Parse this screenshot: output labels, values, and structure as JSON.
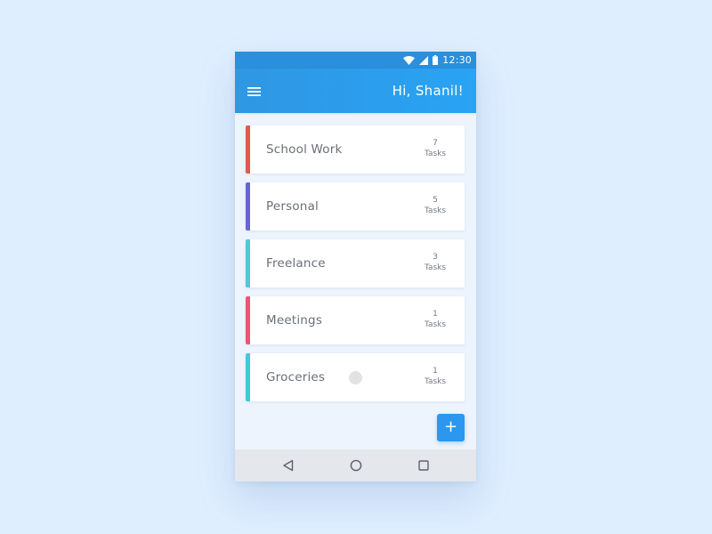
{
  "status_bar": {
    "time": "12:30",
    "icons": [
      "wifi-icon",
      "signal-icon",
      "battery-icon"
    ]
  },
  "app_bar": {
    "greeting": "Hi, Shanil!",
    "menu_icon": "menu-icon",
    "background": "#2a9df0"
  },
  "categories": [
    {
      "name": "School Work",
      "count": "7",
      "count_label": "Tasks",
      "color": "#e05a4f"
    },
    {
      "name": "Personal",
      "count": "5",
      "count_label": "Tasks",
      "color": "#6b63d8"
    },
    {
      "name": "Freelance",
      "count": "3",
      "count_label": "Tasks",
      "color": "#52c7d6"
    },
    {
      "name": "Meetings",
      "count": "1",
      "count_label": "Tasks",
      "color": "#ec5472"
    },
    {
      "name": "Groceries",
      "count": "1",
      "count_label": "Tasks",
      "color": "#3fc9dd"
    }
  ],
  "fab": {
    "label": "+",
    "color": "#2b97ef"
  },
  "nav_bar": {
    "buttons": [
      "back-icon",
      "home-icon",
      "recents-icon"
    ]
  }
}
